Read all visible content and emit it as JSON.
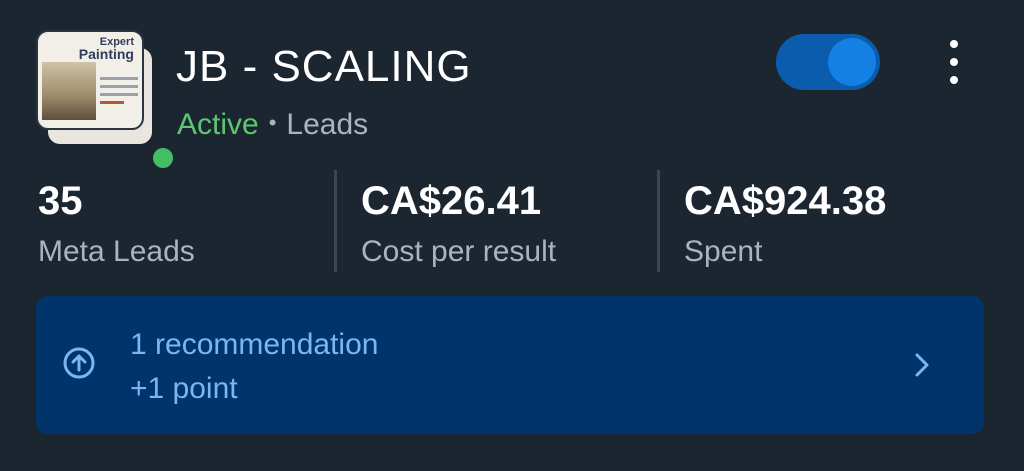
{
  "campaign": {
    "name": "JB - SCALING",
    "status": "Active",
    "separator": "•",
    "objective": "Leads",
    "toggle_on": true,
    "status_color": "#45bd62"
  },
  "thumbnail": {
    "line1": "Expert",
    "line2": "Painting"
  },
  "metrics": [
    {
      "value": "35",
      "label": "Meta Leads"
    },
    {
      "value": "CA$26.41",
      "label": "Cost per result"
    },
    {
      "value": "CA$924.38",
      "label": "Spent"
    }
  ],
  "recommendation": {
    "title": "1 recommendation",
    "points": "+1 point",
    "icon": "arrow-up-circle-icon"
  },
  "icons": {
    "more": "more-vertical-icon",
    "chevron": "chevron-right-icon"
  },
  "colors": {
    "background": "#1c2630",
    "accent": "#1480e3",
    "banner": "#00346b",
    "banner_text": "#7ab6f2"
  }
}
